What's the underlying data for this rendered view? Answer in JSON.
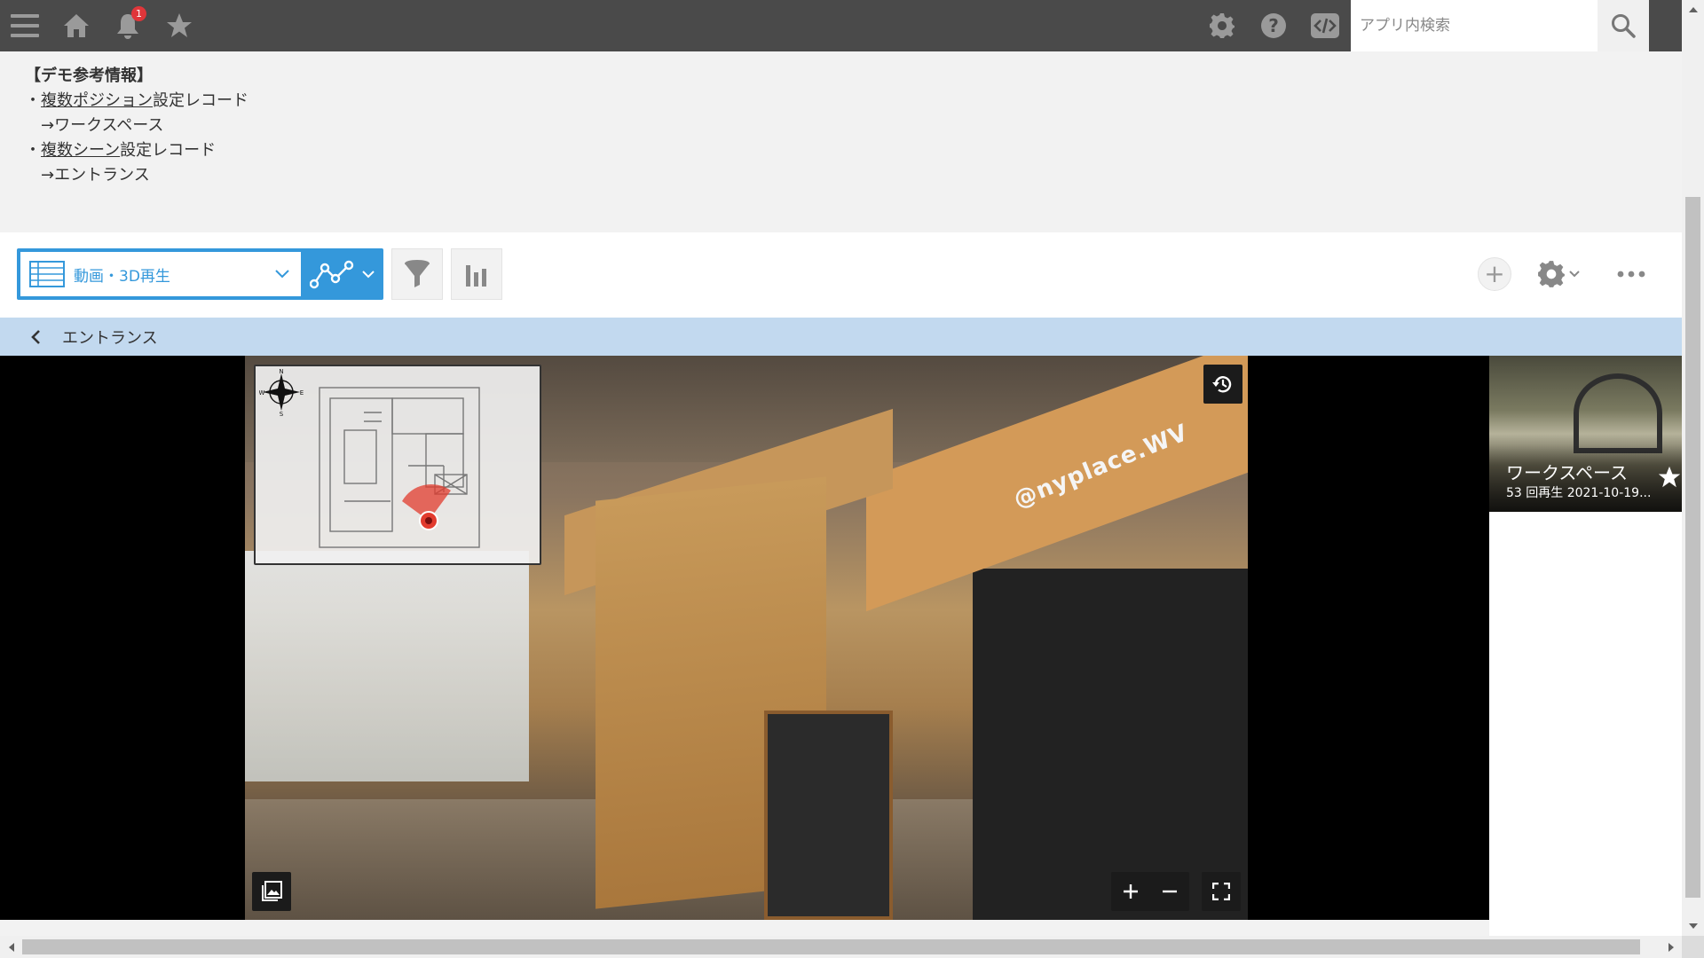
{
  "header": {
    "notification_count": "1",
    "search": {
      "placeholder": "アプリ内検索",
      "value": ""
    }
  },
  "demo_info": {
    "title": "【デモ参考情報】",
    "lines": [
      {
        "bullet": "・",
        "link": "複数ポジション",
        "rest": "設定レコード"
      },
      {
        "text": "→ワークスペース"
      },
      {
        "bullet": "・",
        "link": "複数シーン",
        "rest": "設定レコード"
      },
      {
        "text": "→エントランス"
      }
    ]
  },
  "toolbar": {
    "view_label": "動画・3D再生",
    "add_symbol": "+"
  },
  "breadcrumb": {
    "current": "エントランス"
  },
  "viewer": {
    "sign_text": "@nyplace.WV",
    "compass_letters": {
      "n": "N",
      "s": "S",
      "w": "W",
      "e": "E"
    }
  },
  "scenes": [
    {
      "name": "ワークスペース",
      "meta": "53 回再生 2021-10-19..."
    }
  ],
  "colors": {
    "accent": "#3498db",
    "topbar": "#4a4a4a",
    "breadcrumb_bg": "#c2d9ef",
    "badge": "#e0363a",
    "map_marker": "#e23b2e"
  },
  "icons": {
    "menu": "menu-icon",
    "home": "home-icon",
    "bell": "bell-icon",
    "star": "star-icon",
    "settings": "gear-icon",
    "help": "help-icon",
    "code": "code-icon",
    "search": "search-icon"
  }
}
